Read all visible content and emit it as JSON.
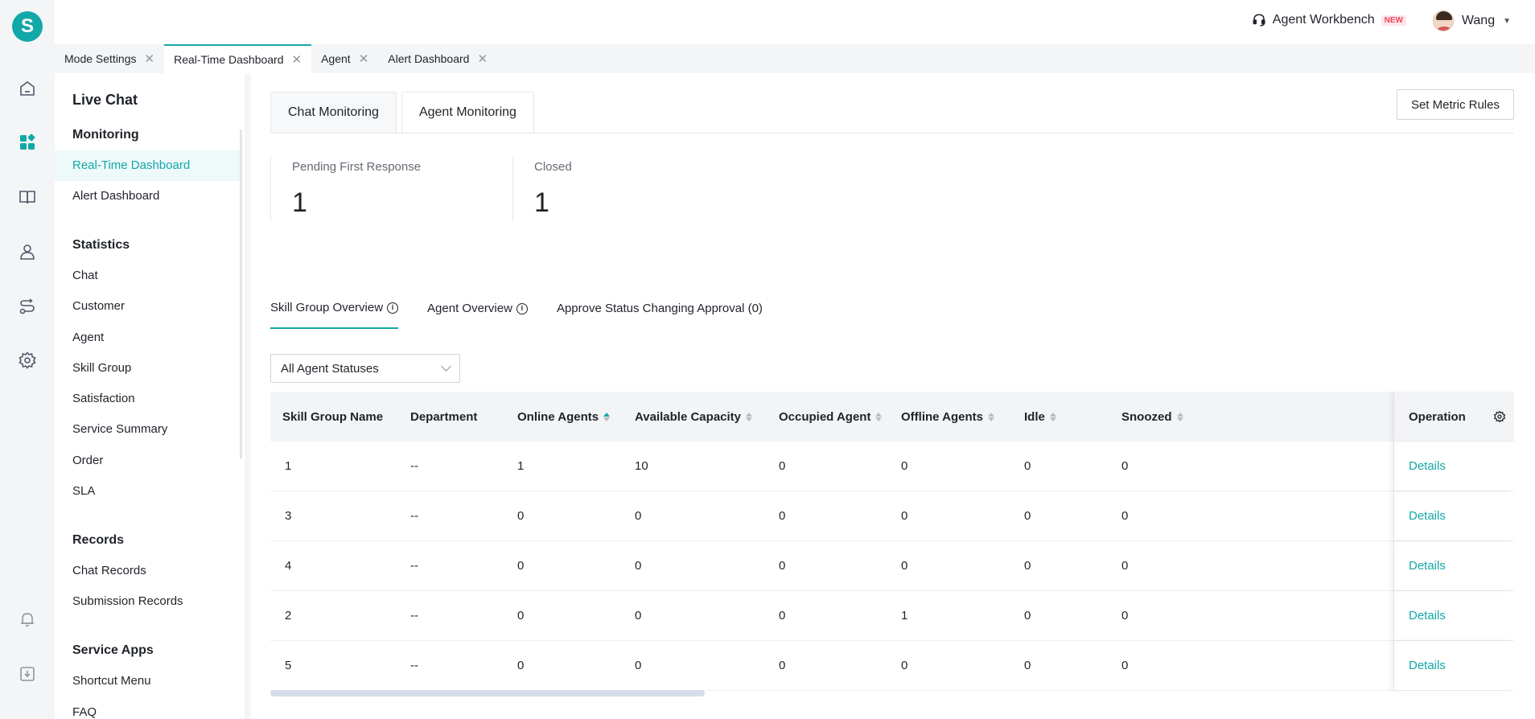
{
  "header": {
    "workbench_label": "Agent Workbench",
    "new_badge": "NEW",
    "user_name": "Wang"
  },
  "logo_letter": "S",
  "tabs": [
    {
      "label": "Mode Settings"
    },
    {
      "label": "Real-Time Dashboard"
    },
    {
      "label": "Agent"
    },
    {
      "label": "Alert Dashboard"
    }
  ],
  "sidebar": {
    "title": "Live Chat",
    "groups": {
      "monitoring": "Monitoring",
      "statistics": "Statistics",
      "records": "Records",
      "service_apps": "Service Apps"
    },
    "items": {
      "realtime": "Real-Time Dashboard",
      "alert": "Alert Dashboard",
      "chat": "Chat",
      "customer": "Customer",
      "agent": "Agent",
      "skill_group": "Skill Group",
      "satisfaction": "Satisfaction",
      "service_summary": "Service Summary",
      "order": "Order",
      "sla": "SLA",
      "chat_records": "Chat Records",
      "submission_records": "Submission Records",
      "shortcut_menu": "Shortcut Menu",
      "faq": "FAQ"
    }
  },
  "monitor_tabs": [
    "Chat Monitoring",
    "Agent Monitoring"
  ],
  "set_metric_rules": "Set Metric Rules",
  "stats": [
    {
      "label": "Pending First Response",
      "value": "1"
    },
    {
      "label": "Closed",
      "value": "1"
    }
  ],
  "subtabs": [
    "Skill Group Overview",
    "Agent Overview",
    "Approve Status Changing Approval (0)"
  ],
  "filter": {
    "value": "All Agent Statuses"
  },
  "table": {
    "columns": [
      "Skill Group Name",
      "Department",
      "Online Agents",
      "Available Capacity",
      "Occupied Agent",
      "Offline Agents",
      "Idle",
      "Snoozed",
      "Operation"
    ],
    "rows": [
      [
        "1",
        "--",
        "1",
        "10",
        "0",
        "0",
        "0",
        "0",
        "Details"
      ],
      [
        "3",
        "--",
        "0",
        "0",
        "0",
        "0",
        "0",
        "0",
        "Details"
      ],
      [
        "4",
        "--",
        "0",
        "0",
        "0",
        "0",
        "0",
        "0",
        "Details"
      ],
      [
        "2",
        "--",
        "0",
        "0",
        "0",
        "1",
        "0",
        "0",
        "Details"
      ],
      [
        "5",
        "--",
        "0",
        "0",
        "0",
        "0",
        "0",
        "0",
        "Details"
      ]
    ]
  },
  "colors": {
    "accent": "#13a8a8",
    "badge": "#f5455c"
  }
}
